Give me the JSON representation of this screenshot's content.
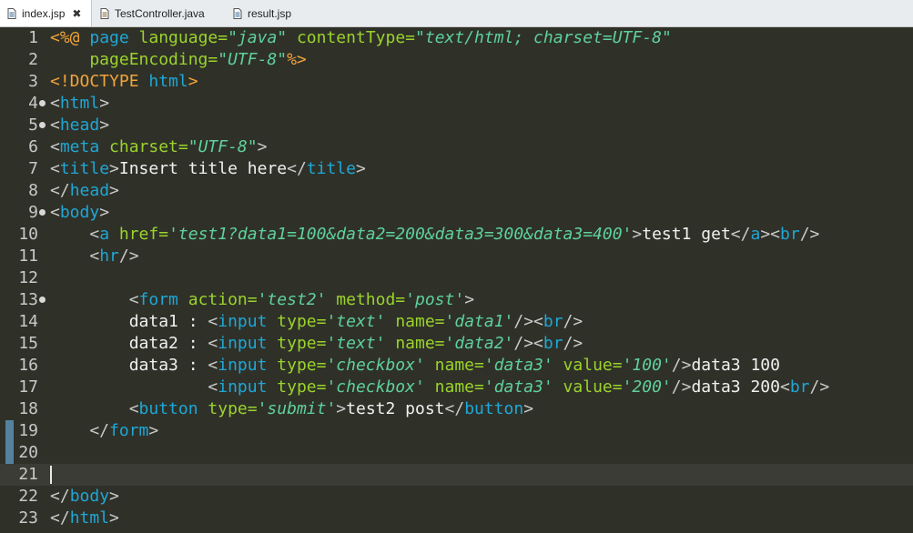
{
  "tabs": [
    {
      "label": "index.jsp",
      "active": true,
      "closable": true
    },
    {
      "label": "TestController.java",
      "active": false,
      "closable": false
    },
    {
      "label": "result.jsp",
      "active": false,
      "closable": false
    }
  ],
  "close_glyph": "✖",
  "colors": {
    "background": "#2f3129",
    "plain": "#f0f0f0",
    "tag": "#1fa7d6",
    "attr": "#9bd32b",
    "string": "#5fd19b",
    "directive": "#f2a33a",
    "punct": "#c9c9c9",
    "line_number": "#c8c8c8"
  },
  "lines": [
    {
      "n": "1",
      "fold": false,
      "segs": [
        [
          "<%@ ",
          "directive"
        ],
        [
          "page ",
          "tag"
        ],
        [
          "language=",
          "attr"
        ],
        [
          "\"java\"",
          "string"
        ],
        [
          " contentType=",
          "attr"
        ],
        [
          "\"text/html; charset=UTF-8\"",
          "string"
        ]
      ]
    },
    {
      "n": "2",
      "fold": false,
      "segs": [
        [
          "    pageEncoding=",
          "attr"
        ],
        [
          "\"UTF-8\"",
          "string"
        ],
        [
          "%>",
          "directive"
        ]
      ]
    },
    {
      "n": "3",
      "fold": false,
      "segs": [
        [
          "<!DOCTYPE ",
          "directive"
        ],
        [
          "html",
          "tag"
        ],
        [
          ">",
          "directive"
        ]
      ]
    },
    {
      "n": "4",
      "fold": true,
      "segs": [
        [
          "<",
          "punct"
        ],
        [
          "html",
          "tag"
        ],
        [
          ">",
          "punct"
        ]
      ]
    },
    {
      "n": "5",
      "fold": true,
      "segs": [
        [
          "<",
          "punct"
        ],
        [
          "head",
          "tag"
        ],
        [
          ">",
          "punct"
        ]
      ]
    },
    {
      "n": "6",
      "fold": false,
      "segs": [
        [
          "<",
          "punct"
        ],
        [
          "meta ",
          "tag"
        ],
        [
          "charset=",
          "attr"
        ],
        [
          "\"UTF-8\"",
          "string"
        ],
        [
          ">",
          "punct"
        ]
      ]
    },
    {
      "n": "7",
      "fold": false,
      "segs": [
        [
          "<",
          "punct"
        ],
        [
          "title",
          "tag"
        ],
        [
          ">",
          "punct"
        ],
        [
          "Insert title here",
          "plain"
        ],
        [
          "</",
          "punct"
        ],
        [
          "title",
          "tag"
        ],
        [
          ">",
          "punct"
        ]
      ]
    },
    {
      "n": "8",
      "fold": false,
      "segs": [
        [
          "</",
          "punct"
        ],
        [
          "head",
          "tag"
        ],
        [
          ">",
          "punct"
        ]
      ]
    },
    {
      "n": "9",
      "fold": true,
      "segs": [
        [
          "<",
          "punct"
        ],
        [
          "body",
          "tag"
        ],
        [
          ">",
          "punct"
        ]
      ]
    },
    {
      "n": "10",
      "fold": false,
      "segs": [
        [
          "    <",
          "punct"
        ],
        [
          "a ",
          "tag"
        ],
        [
          "href=",
          "attr"
        ],
        [
          "'test1?data1=100&data2=200&data3=300&data3=400'",
          "string"
        ],
        [
          ">",
          "punct"
        ],
        [
          "test1 get",
          "plain"
        ],
        [
          "</",
          "punct"
        ],
        [
          "a",
          "tag"
        ],
        [
          "><",
          "punct"
        ],
        [
          "br",
          "tag"
        ],
        [
          "/>",
          "punct"
        ]
      ]
    },
    {
      "n": "11",
      "fold": false,
      "segs": [
        [
          "    <",
          "punct"
        ],
        [
          "hr",
          "tag"
        ],
        [
          "/>",
          "punct"
        ]
      ]
    },
    {
      "n": "12",
      "fold": false,
      "segs": []
    },
    {
      "n": "13",
      "fold": true,
      "segs": [
        [
          "        <",
          "punct"
        ],
        [
          "form ",
          "tag"
        ],
        [
          "action=",
          "attr"
        ],
        [
          "'test2'",
          "string"
        ],
        [
          " method=",
          "attr"
        ],
        [
          "'post'",
          "string"
        ],
        [
          ">",
          "punct"
        ]
      ]
    },
    {
      "n": "14",
      "fold": false,
      "segs": [
        [
          "        data1 : ",
          "plain"
        ],
        [
          "<",
          "punct"
        ],
        [
          "input ",
          "tag"
        ],
        [
          "type=",
          "attr"
        ],
        [
          "'text'",
          "string"
        ],
        [
          " name=",
          "attr"
        ],
        [
          "'data1'",
          "string"
        ],
        [
          "/><",
          "punct"
        ],
        [
          "br",
          "tag"
        ],
        [
          "/>",
          "punct"
        ]
      ]
    },
    {
      "n": "15",
      "fold": false,
      "segs": [
        [
          "        data2 : ",
          "plain"
        ],
        [
          "<",
          "punct"
        ],
        [
          "input ",
          "tag"
        ],
        [
          "type=",
          "attr"
        ],
        [
          "'text'",
          "string"
        ],
        [
          " name=",
          "attr"
        ],
        [
          "'data2'",
          "string"
        ],
        [
          "/><",
          "punct"
        ],
        [
          "br",
          "tag"
        ],
        [
          "/>",
          "punct"
        ]
      ]
    },
    {
      "n": "16",
      "fold": false,
      "segs": [
        [
          "        data3 : ",
          "plain"
        ],
        [
          "<",
          "punct"
        ],
        [
          "input ",
          "tag"
        ],
        [
          "type=",
          "attr"
        ],
        [
          "'checkbox'",
          "string"
        ],
        [
          " name=",
          "attr"
        ],
        [
          "'data3'",
          "string"
        ],
        [
          " value=",
          "attr"
        ],
        [
          "'100'",
          "string"
        ],
        [
          "/>",
          "punct"
        ],
        [
          "data3 100",
          "plain"
        ]
      ]
    },
    {
      "n": "17",
      "fold": false,
      "segs": [
        [
          "                <",
          "punct"
        ],
        [
          "input ",
          "tag"
        ],
        [
          "type=",
          "attr"
        ],
        [
          "'checkbox'",
          "string"
        ],
        [
          " name=",
          "attr"
        ],
        [
          "'data3'",
          "string"
        ],
        [
          " value=",
          "attr"
        ],
        [
          "'200'",
          "string"
        ],
        [
          "/>",
          "punct"
        ],
        [
          "data3 200",
          "plain"
        ],
        [
          "<",
          "punct"
        ],
        [
          "br",
          "tag"
        ],
        [
          "/>",
          "punct"
        ]
      ]
    },
    {
      "n": "18",
      "fold": false,
      "segs": [
        [
          "        <",
          "punct"
        ],
        [
          "button ",
          "tag"
        ],
        [
          "type=",
          "attr"
        ],
        [
          "'submit'",
          "string"
        ],
        [
          ">",
          "punct"
        ],
        [
          "test2 post",
          "plain"
        ],
        [
          "</",
          "punct"
        ],
        [
          "button",
          "tag"
        ],
        [
          ">",
          "punct"
        ]
      ]
    },
    {
      "n": "19",
      "fold": false,
      "segs": [
        [
          "    </",
          "punct"
        ],
        [
          "form",
          "tag"
        ],
        [
          ">",
          "punct"
        ]
      ]
    },
    {
      "n": "20",
      "fold": false,
      "segs": []
    },
    {
      "n": "21",
      "fold": false,
      "current": true,
      "segs": []
    },
    {
      "n": "22",
      "fold": false,
      "segs": [
        [
          "</",
          "punct"
        ],
        [
          "body",
          "tag"
        ],
        [
          ">",
          "punct"
        ]
      ]
    },
    {
      "n": "23",
      "fold": false,
      "segs": [
        [
          "</",
          "punct"
        ],
        [
          "html",
          "tag"
        ],
        [
          ">",
          "punct"
        ]
      ]
    }
  ]
}
